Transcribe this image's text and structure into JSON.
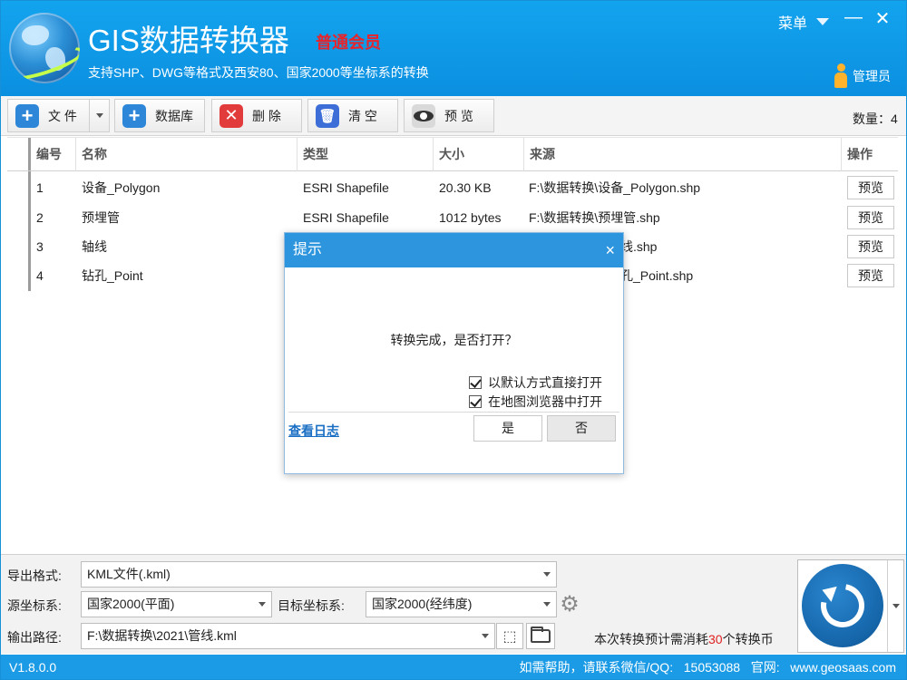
{
  "header": {
    "app_title": "GIS数据转换器",
    "member_level": "普通会员",
    "subtitle": "支持SHP、DWG等格式及西安80、国家2000等坐标系的转换",
    "menu_label": "菜单",
    "minimize_glyph": "—",
    "close_glyph": "✕",
    "user_label": "管理员"
  },
  "toolbar": {
    "file_label": "文 件",
    "database_label": "数据库",
    "delete_label": "删 除",
    "clear_label": "清 空",
    "preview_label": "预 览",
    "count_label": "数量：4"
  },
  "table": {
    "columns": [
      "编号",
      "名称",
      "类型",
      "大小",
      "来源",
      "操作"
    ],
    "rows": [
      {
        "num": "1",
        "name": "设备_Polygon",
        "type": "ESRI Shapefile",
        "size": "20.30 KB",
        "source": "F:\\数据转换\\设备_Polygon.shp",
        "action": "预览"
      },
      {
        "num": "2",
        "name": "预埋管",
        "type": "ESRI Shapefile",
        "size": "1012 bytes",
        "source": "F:\\数据转换\\预埋管.shp",
        "action": "预览"
      },
      {
        "num": "3",
        "name": "轴线",
        "type": "",
        "size": "",
        "source": "线.shp",
        "action": "预览"
      },
      {
        "num": "4",
        "name": "钻孔_Point",
        "type": "",
        "size": "",
        "source": "孔_Point.shp",
        "action": "预览"
      }
    ]
  },
  "dialog": {
    "title": "提示",
    "close_glyph": "×",
    "message": "转换完成，是否打开？",
    "option1": "以默认方式直接打开",
    "option2": "在地图浏览器中打开",
    "view_log": "查看日志",
    "yes": "是",
    "no": "否"
  },
  "bottom": {
    "format_label": "导出格式:",
    "format_value": "KML文件(.kml)",
    "src_crs_label": "源坐标系:",
    "src_crs_value": "国家2000(平面)",
    "dst_crs_label": "目标坐标系:",
    "dst_crs_value": "国家2000(经纬度)",
    "output_label": "输出路径:",
    "output_value": "F:\\数据转换\\2021\\管线.kml",
    "cost_prefix": "本次转换预计需消耗",
    "cost_amount": "30",
    "cost_suffix": "个转换币"
  },
  "status": {
    "version": "V1.8.0.0",
    "help": "如需帮助，请联系微信/QQ:   15053088   官网:   www.geosaas.com"
  },
  "colors": {
    "header_blue": "#13a4ee",
    "member_red": "#e8232a",
    "dialog_title_blue": "#2c95dd",
    "status_blue": "#1b9be6"
  }
}
